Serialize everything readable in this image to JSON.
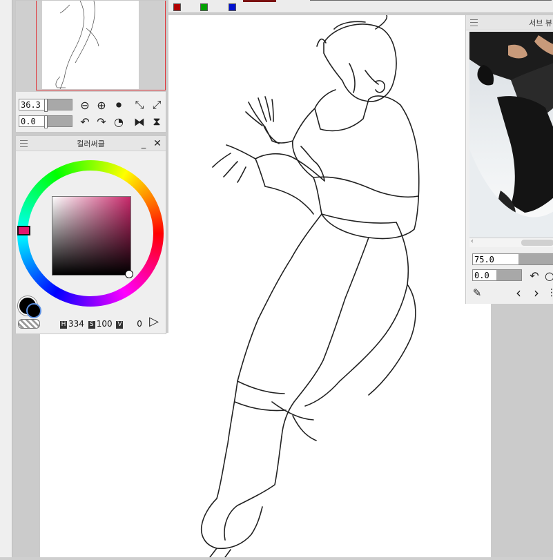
{
  "navigator": {
    "zoom_value": "36.3",
    "rotation_value": "0.0",
    "icons": [
      "zoom-out-icon",
      "zoom-in-icon",
      "zoom-reset-icon",
      "fit-window-icon",
      "actual-size-icon",
      "rotate-left-icon",
      "rotate-right-icon",
      "rotate-reset-icon",
      "flip-horizontal-icon",
      "flip-vertical-icon"
    ]
  },
  "color_panel": {
    "title": "컬러써클",
    "h_label": "H",
    "h_value": "334",
    "s_label": "S",
    "s_value": "100",
    "v_label": "V",
    "v_value": "0",
    "main_color": "#000000",
    "sub_color": "#000000",
    "hue_color": "#e3156d"
  },
  "sub_view": {
    "title": "서브 뷰",
    "zoom_value": "75.0",
    "rotation_value": "0.0"
  },
  "top_strip": {
    "swatch_colors": [
      "#b00000",
      "#00a000",
      "#0010d0"
    ]
  }
}
